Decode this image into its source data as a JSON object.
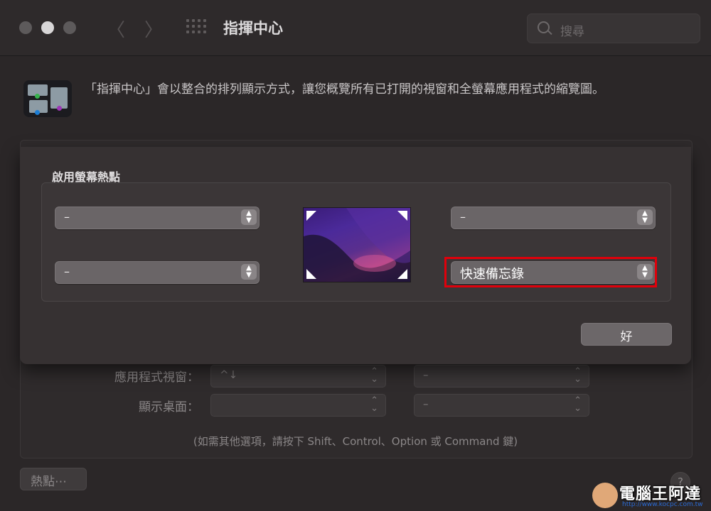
{
  "window": {
    "title": "指揮中心",
    "search_placeholder": "搜尋",
    "nav_back_glyph": "〈",
    "nav_forward_glyph": "〉"
  },
  "header": {
    "description": "「指揮中心」會以整合的排列顯示方式，讓您概覽所有已打開的視窗和全螢幕應用程式的縮覽圖。"
  },
  "background": {
    "rows": [
      {
        "label": "應用程式視窗：",
        "left_value": "^↓",
        "right_value": "–"
      },
      {
        "label": "顯示桌面：",
        "left_value": "",
        "right_value": "–"
      }
    ],
    "hint": "(如需其他選項，請按下 Shift、Control、Option 或 Command 鍵)",
    "hot_corners_button": "熱點⋯",
    "help_button": "?"
  },
  "sheet": {
    "title": "啟用螢幕熱點",
    "top_left": "–",
    "bottom_left": "–",
    "top_right": "–",
    "bottom_right": "快速備忘錄",
    "ok_button": "好"
  },
  "watermark": {
    "text": "電腦王阿達",
    "url": "http://www.kocpc.com.tw"
  },
  "colors": {
    "highlight": "#e0000b",
    "background": "#2b2728",
    "sheet": "#363132"
  }
}
